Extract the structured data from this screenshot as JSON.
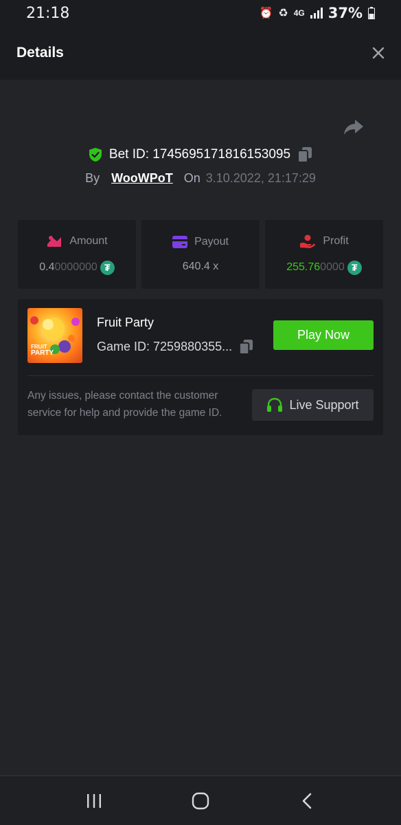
{
  "status_bar": {
    "time": "21:18",
    "network": "4G",
    "battery": "37%"
  },
  "header": {
    "title": "Details"
  },
  "bet": {
    "id_label": "Bet ID: 1745695171816153095",
    "by_label": "By",
    "user": "WooWPoT",
    "on_label": "On",
    "date": "3.10.2022, 21:17:29"
  },
  "stats": {
    "amount": {
      "label": "Amount",
      "value_main": "0.4",
      "value_dim": "0000000"
    },
    "payout": {
      "label": "Payout",
      "value": "640.4 x"
    },
    "profit": {
      "label": "Profit",
      "value_main": "255.76",
      "value_dim": "0000"
    }
  },
  "game": {
    "name": "Fruit Party",
    "game_id": "Game ID: 7259880355...",
    "thumb_text_1": "FRUIT",
    "thumb_text_2": "PARTY",
    "play_label": "Play Now"
  },
  "support": {
    "text": "Any issues, please contact the customer service for help and provide the game ID.",
    "button_label": "Live Support"
  },
  "colors": {
    "accent_green": "#3dc51b",
    "tether": "#26a17b",
    "amount_icon": "#e0306a",
    "payout_icon": "#7b3fe4",
    "profit_icon": "#e0303a"
  }
}
